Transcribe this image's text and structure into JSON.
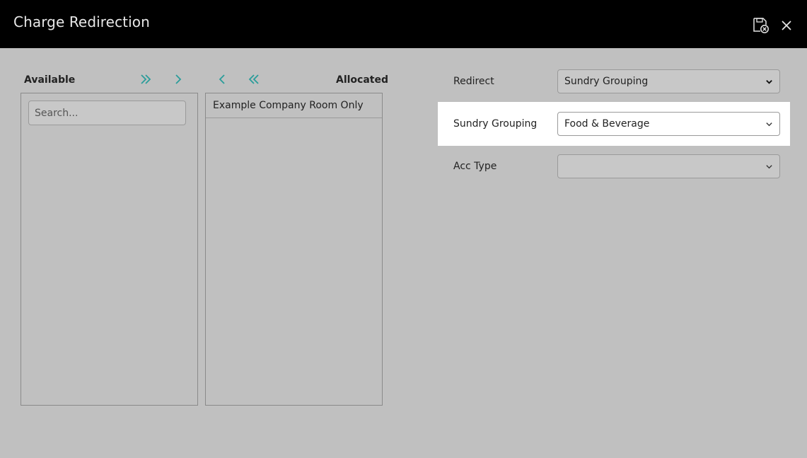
{
  "window": {
    "title": "Charge Redirection"
  },
  "lists": {
    "available_label": "Available",
    "allocated_label": "Allocated",
    "search_placeholder": "Search...",
    "allocated_items": [
      "Example Company Room Only"
    ]
  },
  "form": {
    "redirect": {
      "label": "Redirect",
      "value": "Sundry Grouping"
    },
    "sundry_grouping": {
      "label": "Sundry Grouping",
      "value": "Food & Beverage"
    },
    "acc_type": {
      "label": "Acc Type",
      "value": ""
    }
  },
  "colors": {
    "header_bg": "#000000",
    "body_bg": "#c0c0c0",
    "accent_teal": "#2a9d9a",
    "highlight_bg": "#ffffff"
  },
  "icons": {
    "save": "save-cancel-icon",
    "close": "close-icon",
    "move_all_right": "double-chevron-right-icon",
    "move_right": "chevron-right-icon",
    "move_left": "chevron-left-icon",
    "move_all_left": "double-chevron-left-icon",
    "dropdown": "chevron-down-icon"
  }
}
